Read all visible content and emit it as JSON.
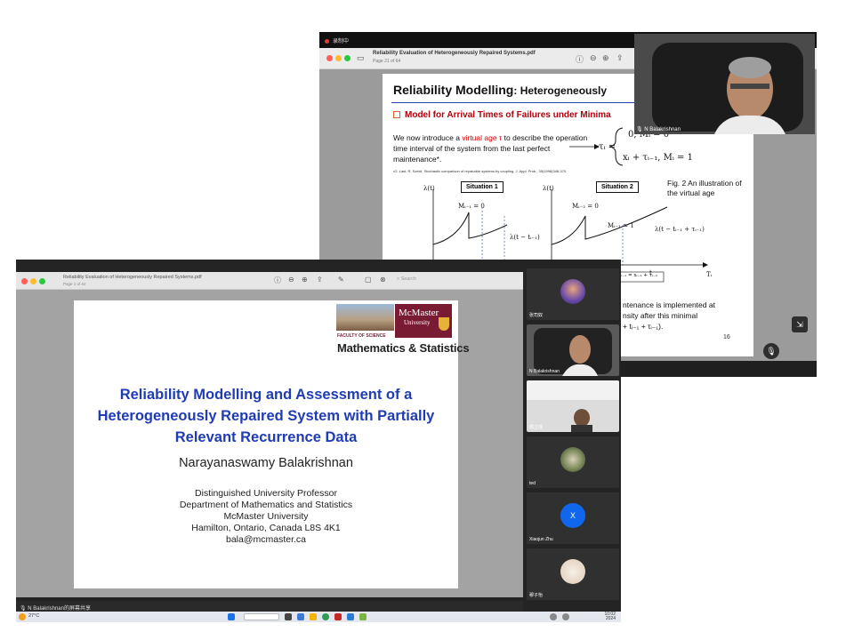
{
  "back_window": {
    "recording_label": "录制中",
    "doc_title": "Reliability Evaluation of Heterogeneously Repaired Systems.pdf",
    "page_indicator": "Page 21 of 64",
    "slide": {
      "title_main": "Reliability Modelling",
      "title_sub": ": Heterogeneously",
      "heading": "Model for Arrival Times of Failures under Minima",
      "intro_pre": "We now introduce a ",
      "intro_red": "virtual age τ",
      "intro_post": " to describe the operation time interval of the system from the last perfect maintenance*.",
      "reference": "•G. Last, R. Szekli, Stochastic comparison of repairable systems by coupling, J. Appl. Prob., 35(1998)348-370.",
      "formula_lhs": "τᵢ =",
      "formula_row1": "0,          Mᵢ = 0",
      "formula_row2": "xᵢ + τᵢ₋₁,   Mᵢ = 1",
      "fig_caption": "Fig. 2 An illustration of the virtual age",
      "situation1": "Situation 1",
      "situation2": "Situation 2",
      "lambda_t": "λ(t)",
      "m1_label": "Mᵢ₋₁ = 0",
      "m2_label": "Mᵢ₋₂ = 0",
      "m3_label": "Mᵢ₋₁ = 1",
      "curve1_label": "λ(t − tᵢ₋₁)",
      "curve2_label": "λ(t − tᵢ₋₁ + τᵢ₋₁)",
      "axis_t": "t",
      "axis_ti": "Tᵢ",
      "tau_box": "ᵢ₋₁ = xᵢ₋₁ + τᵢ₋₂",
      "bottom_text1": "ntenance is implemented at",
      "bottom_text2": "nsity after this minimal",
      "bottom_text3": "+ tᵢ₋₁ + τᵢ₋₁).",
      "page_number": "16"
    },
    "speaker_name": "N Balakrishnan"
  },
  "front_window": {
    "doc_title": "Reliability Evaluation of Heterogeneously Repaired Systems.pdf",
    "page_indicator": "Page 1 of 64",
    "search_placeholder": "Search",
    "logo": {
      "name_line1": "McMaster",
      "name_line2": "University",
      "faculty": "FACULTY OF SCIENCE",
      "department": "Mathematics & Statistics"
    },
    "slide_title": "Reliability Modelling and Assessment of a Heterogeneously Repaired System with Partially Relevant Recurrence Data",
    "author": "Narayanaswamy Balakrishnan",
    "affiliation": [
      "Distinguished University Professor",
      "Department of Mathematics and Statistics",
      "McMaster University",
      "Hamilton, Ontario, Canada L8S 4K1",
      "bala@mcmaster.ca"
    ],
    "share_label": "N Balakrishnan的屏幕共享",
    "participants": [
      {
        "name": "张司奴"
      },
      {
        "name": "N Balakrishnan"
      },
      {
        "name": "喻立成"
      },
      {
        "name": "ted"
      },
      {
        "name": "Xiaojun Zhu",
        "initial": "X"
      },
      {
        "name": "穆子怡"
      }
    ]
  },
  "taskbar": {
    "temperature": "27°C",
    "time": "10:02",
    "date": "2024"
  },
  "colors": {
    "slide_title_blue": "#1f3cb4",
    "mcmaster_maroon": "#7a1b34",
    "accent_red": "#d40000"
  }
}
